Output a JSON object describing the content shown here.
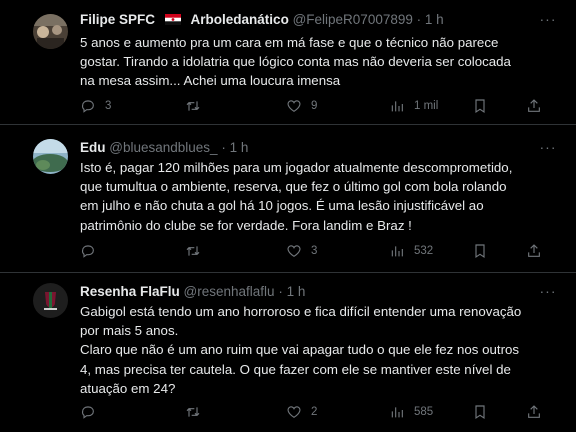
{
  "tweets": [
    {
      "name": "Filipe SPFC",
      "display_suffix": "Arboledanático",
      "handle": "@FelipeR07007899",
      "dot": "·",
      "time": "1 h",
      "text": "5 anos e aumento pra um cara em má fase e que o técnico não parece\ngostar. Tirando a idolatria que lógico conta mas não deveria ser colocada\nna mesa assim... Achei uma loucura imensa",
      "replies": "3",
      "retweets": "",
      "likes": "9",
      "views": "1 mil"
    },
    {
      "name": "Edu",
      "handle": "@bluesandblues_",
      "dot": "·",
      "time": "1 h",
      "text": "Isto é, pagar 120 milhões para um jogador atualmente descomprometido,\nque tumultua o ambiente, reserva, que fez o último gol com bola rolando\nem julho e não chuta a gol há 10 jogos. É uma lesão injustificável ao\npatrimônio do clube se for verdade.  Fora landim e Braz !",
      "replies": "",
      "retweets": "",
      "likes": "3",
      "views": "532"
    },
    {
      "name": "Resenha FlaFlu",
      "handle": "@resenhaflaflu",
      "dot": "·",
      "time": "1 h",
      "text": "Gabigol está tendo um ano horroroso e fica difícil entender uma renovação\npor mais 5 anos.\nClaro que não é um ano ruim que vai apagar tudo o que ele fez nos outros\n4, mas precisa ter cautela. O que fazer com ele se mantiver este nível de\natuação em 24?",
      "replies": "",
      "retweets": "",
      "likes": "2",
      "views": "585"
    }
  ],
  "icons": {
    "reply": "reply-icon",
    "retweet": "retweet-icon",
    "like": "heart-icon",
    "views": "views-bar-chart-icon",
    "bookmark": "bookmark-icon",
    "share": "share-icon",
    "more": "more-options-icon"
  },
  "colors": {
    "background": "#000000",
    "text": "#e7e9ea",
    "muted": "#71767b",
    "border": "#2f3336"
  }
}
